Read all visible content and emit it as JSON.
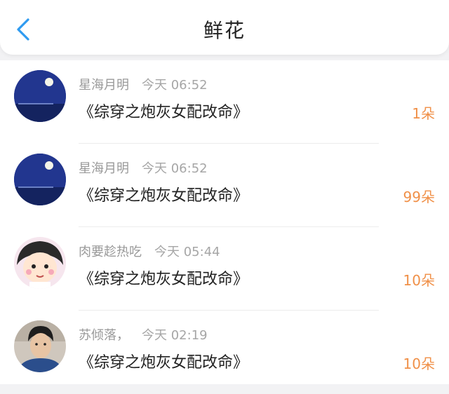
{
  "header": {
    "title": "鲜花",
    "back_icon": "chevron-left-icon"
  },
  "accent_color": "#f09048",
  "back_color": "#2f9bf0",
  "items": [
    {
      "user": "星海月明",
      "time": "今天 06:52",
      "book": "《综穿之炮灰女配改命》",
      "count": "1朵"
    },
    {
      "user": "星海月明",
      "time": "今天 06:52",
      "book": "《综穿之炮灰女配改命》",
      "count": "99朵"
    },
    {
      "user": "肉要趁热吃",
      "time": "今天 05:44",
      "book": "《综穿之炮灰女配改命》",
      "count": "10朵"
    },
    {
      "user": "苏倾落，",
      "time": "今天 02:19",
      "book": "《综穿之炮灰女配改命》",
      "count": "10朵"
    }
  ]
}
